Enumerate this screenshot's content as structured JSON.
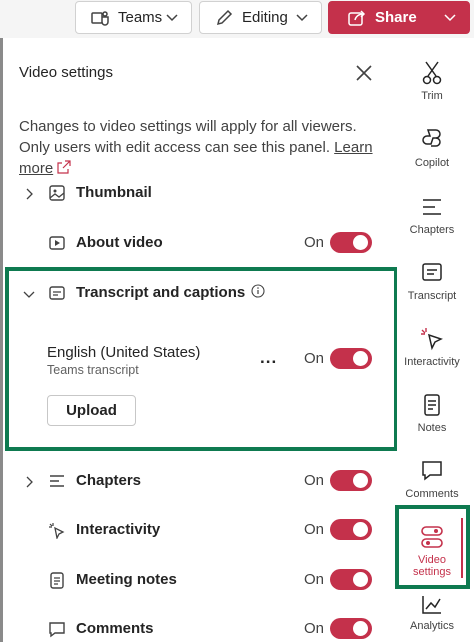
{
  "toolbar": {
    "teams_label": "Teams",
    "editing_label": "Editing",
    "share_label": "Share"
  },
  "panel": {
    "title": "Video settings",
    "description": "Changes to video settings will apply for all viewers. Only users with edit access can see this panel.",
    "learn_more": "Learn more",
    "on_label": "On",
    "rows": {
      "thumbnail": "Thumbnail",
      "about_video": "About video",
      "transcript": "Transcript and captions",
      "chapters": "Chapters",
      "interactivity": "Interactivity",
      "meeting_notes": "Meeting notes",
      "comments": "Comments"
    },
    "transcript_item": {
      "language": "English (United States)",
      "source": "Teams transcript",
      "more": "...",
      "upload": "Upload"
    }
  },
  "rail": {
    "trim": "Trim",
    "copilot": "Copilot",
    "chapters": "Chapters",
    "transcript": "Transcript",
    "interactivity": "Interactivity",
    "notes": "Notes",
    "comments": "Comments",
    "video_settings_line1": "Video",
    "video_settings_line2": "settings",
    "analytics": "Analytics"
  },
  "colors": {
    "accent": "#c4314b",
    "highlight": "#0e7a50"
  }
}
